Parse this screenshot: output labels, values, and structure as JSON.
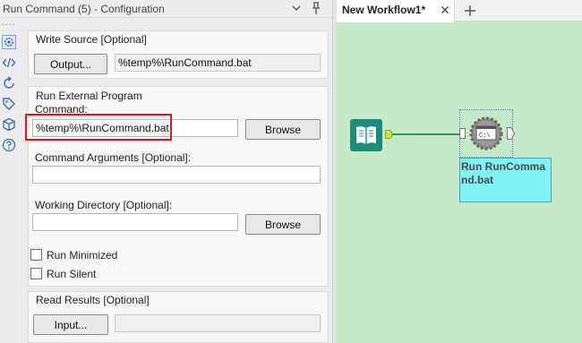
{
  "config": {
    "title": "Run Command (5) - Configuration",
    "dots": "....",
    "write_source": {
      "title": "Write Source [Optional]",
      "output_button": "Output...",
      "output_value": "%temp%\\RunCommand.bat"
    },
    "run_external": {
      "title": "Run External Program",
      "command_label": "Command:",
      "command_value": "%temp%\\RunCommand.bat",
      "browse_label": "Browse",
      "args_label": "Command Arguments [Optional]:",
      "args_value": "",
      "workdir_label": "Working Directory [Optional]:",
      "workdir_value": "",
      "browse2_label": "Browse",
      "run_minimized_label": "Run Minimized",
      "run_minimized_checked": false,
      "run_silent_label": "Run Silent",
      "run_silent_checked": false
    },
    "read_results": {
      "title": "Read Results [Optional]",
      "input_button": "Input...",
      "input_value": ""
    }
  },
  "workflow": {
    "tab_title": "New Workflow1*",
    "tool_label": "Run RunCommand.bat",
    "icon_text": "C:\\"
  },
  "colors": {
    "canvas_bg": "#c6e9c8",
    "highlight": "#e0141e",
    "input_tool": "#1d8a7a",
    "label_bg": "#7ff3f5"
  }
}
